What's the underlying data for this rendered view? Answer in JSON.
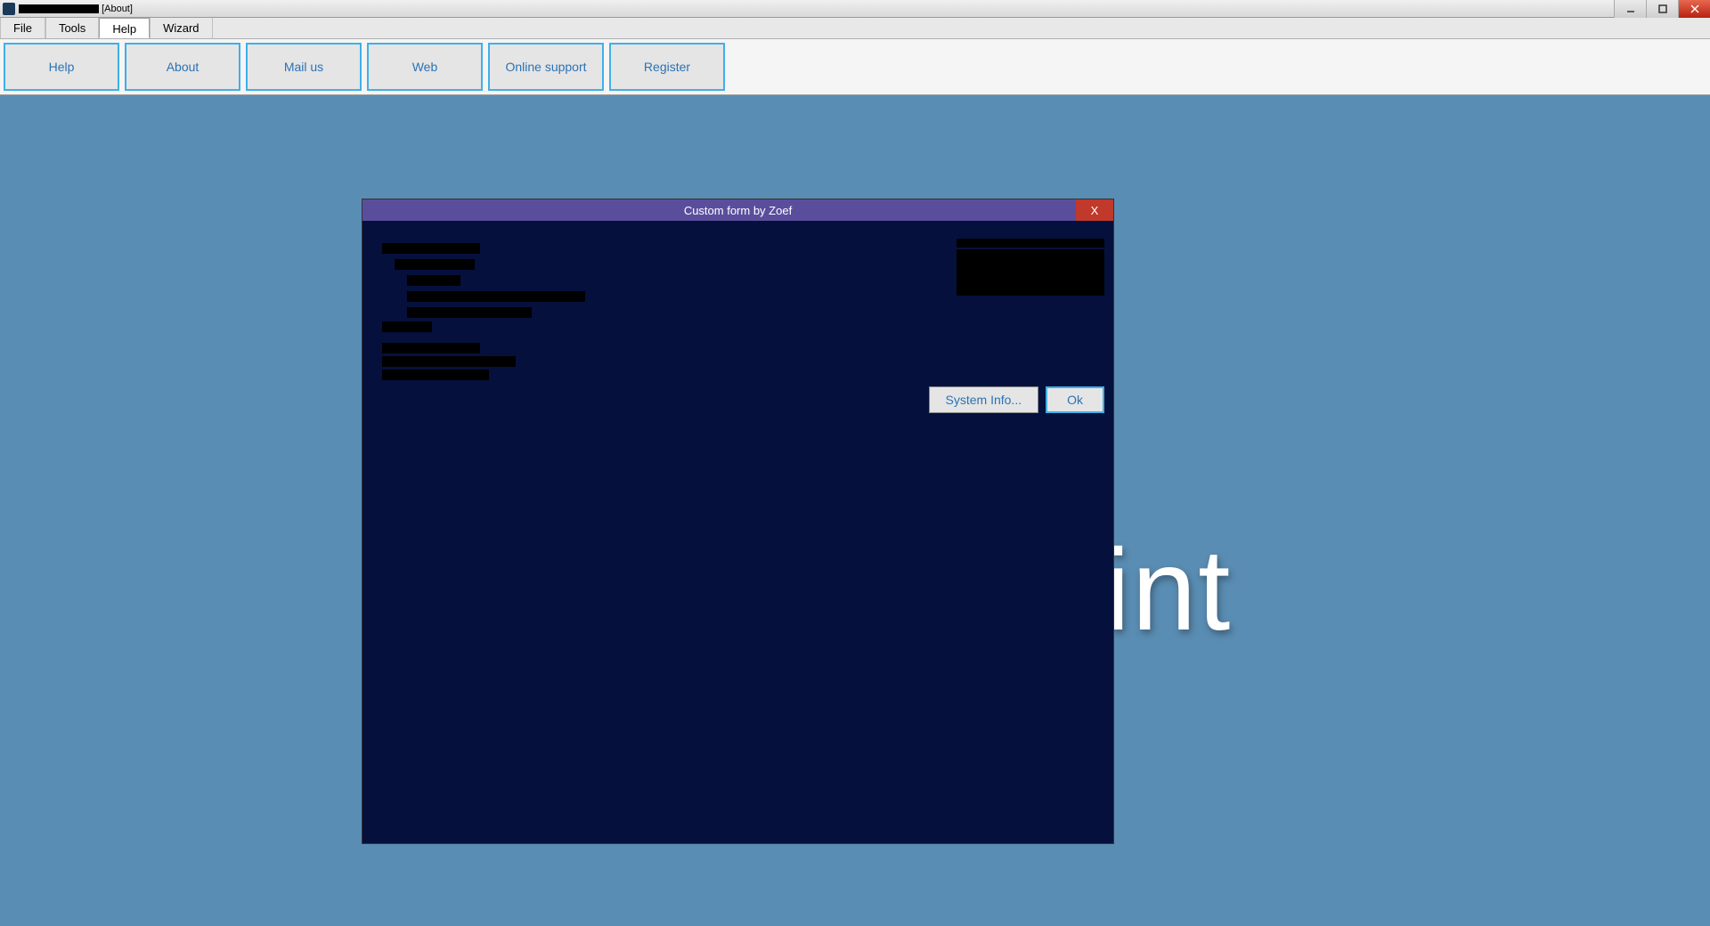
{
  "window": {
    "title_suffix": "[About]",
    "title_rest": ""
  },
  "menu": {
    "items": [
      "File",
      "Tools",
      "Help",
      "Wizard"
    ],
    "selected_index": 2
  },
  "ribbon": {
    "buttons": [
      "Help",
      "About",
      "Mail us",
      "Web",
      "Online support",
      "Register"
    ]
  },
  "workspace": {
    "background_text": "int"
  },
  "dialog": {
    "title": "Custom form by Zoef",
    "close_label": "X",
    "buttons": {
      "system_info": "System Info...",
      "ok": "Ok"
    }
  }
}
